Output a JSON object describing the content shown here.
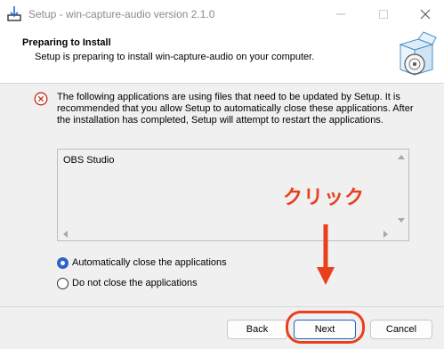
{
  "window": {
    "title": "Setup - win-capture-audio version 2.1.0",
    "icon": "installer-download-icon"
  },
  "header": {
    "title": "Preparing to Install",
    "subtitle": "Setup is preparing to install win-capture-audio on your computer.",
    "graphic": "installer-box-disc-icon"
  },
  "message": {
    "icon": "error-circle-icon",
    "text": "The following applications are using files that need to be updated by Setup. It is recommended that you allow Setup to automatically close these applications. After the installation has completed, Setup will attempt to restart the applications."
  },
  "app_list": {
    "items": [
      "OBS Studio"
    ]
  },
  "options": [
    {
      "label": "Automatically close the applications",
      "selected": true
    },
    {
      "label": "Do not close the applications",
      "selected": false
    }
  ],
  "annotation": {
    "text": "クリック",
    "color": "#e8401c"
  },
  "buttons": {
    "back": "Back",
    "next": "Next",
    "cancel": "Cancel"
  },
  "colors": {
    "accent": "#2b65c8",
    "annotation": "#e8401c"
  }
}
